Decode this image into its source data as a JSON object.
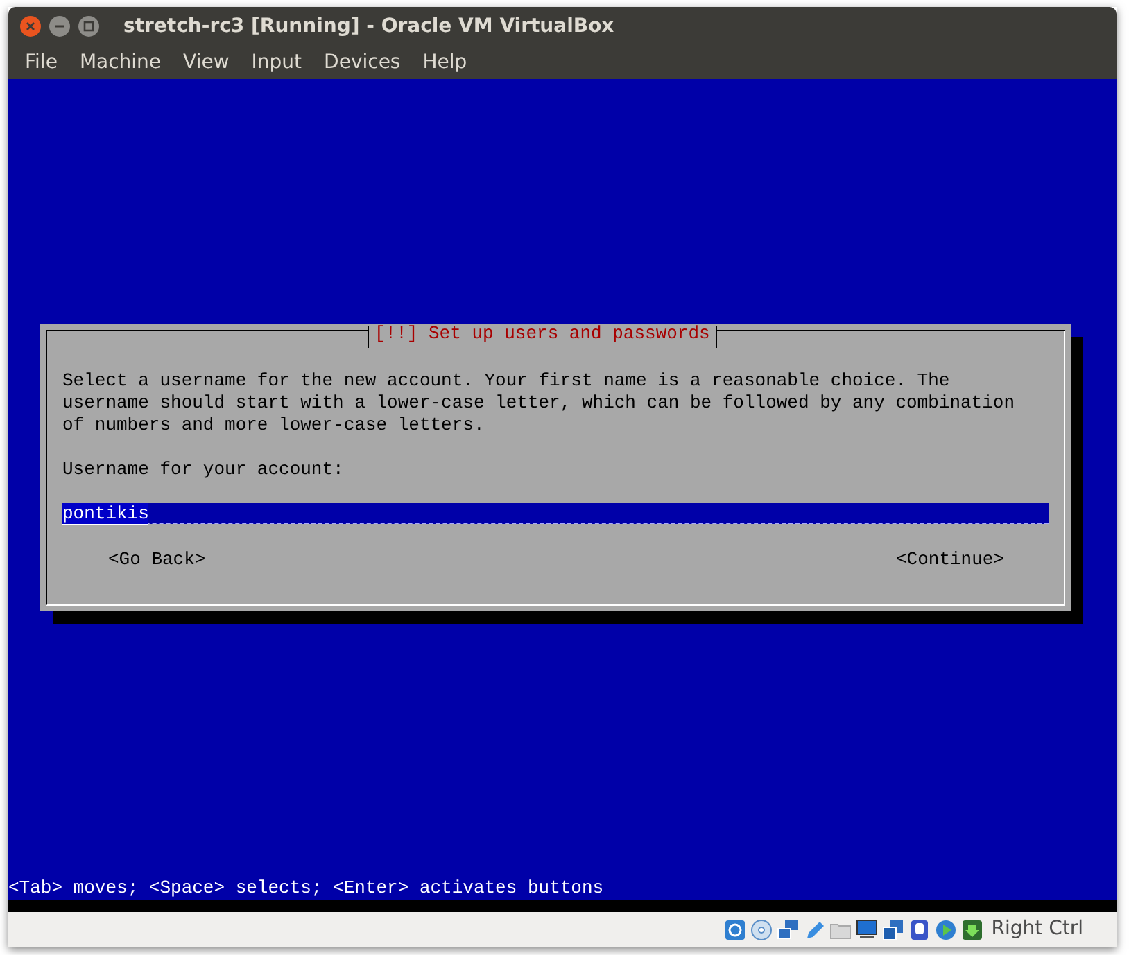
{
  "window": {
    "title": "stretch-rc3 [Running] - Oracle VM VirtualBox"
  },
  "menu": [
    "File",
    "Machine",
    "View",
    "Input",
    "Devices",
    "Help"
  ],
  "dialog": {
    "title": "[!!] Set up users and passwords",
    "message": "Select a username for the new account. Your first name is a reasonable choice. The\nusername should start with a lower-case letter, which can be followed by any combination\nof numbers and more lower-case letters.",
    "field_label": "Username for your account:",
    "field": {
      "value": "pontikis"
    },
    "buttons": [
      "<Go Back>",
      "<Continue>"
    ]
  },
  "hint": "<Tab> moves; <Space> selects; <Enter> activates buttons",
  "status_bar": {
    "host_key": "Right Ctrl"
  }
}
